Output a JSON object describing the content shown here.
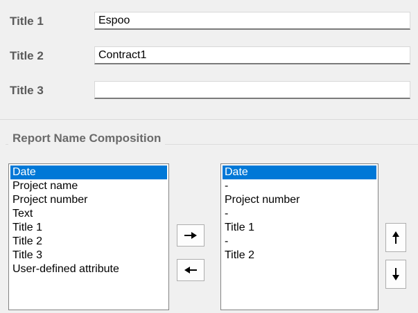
{
  "titles": [
    {
      "label": "Title 1",
      "value": "Espoo"
    },
    {
      "label": "Title 2",
      "value": "Contract1"
    },
    {
      "label": "Title 3",
      "value": ""
    }
  ],
  "composition": {
    "group_title": "Report Name Composition",
    "available": [
      "Date",
      "Project name",
      "Project number",
      "Text",
      "Title 1",
      "Title 2",
      "Title 3",
      "User-defined attribute"
    ],
    "available_selected_index": 0,
    "selected": [
      "Date",
      "-",
      "Project number",
      "-",
      "Title 1",
      "-",
      "Title 2"
    ],
    "selected_selected_index": 0
  },
  "buttons": {
    "add_icon": "arrow-right-icon",
    "remove_icon": "arrow-left-icon",
    "move_up_icon": "arrow-up-icon",
    "move_down_icon": "arrow-down-icon"
  },
  "colors": {
    "selection": "#0078d7",
    "label": "#5a5a5a"
  }
}
